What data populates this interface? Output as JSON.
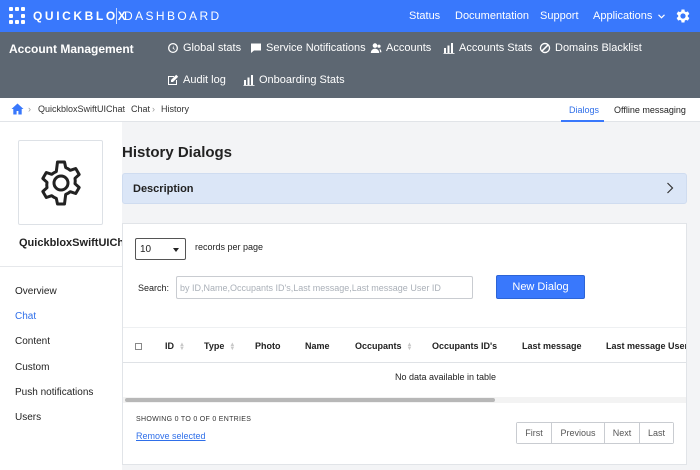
{
  "topbar": {
    "brand": "QUICKBLOX",
    "section": "DASHBOARD",
    "links": [
      "Status",
      "Documentation",
      "Support",
      "Applications"
    ],
    "settings_icon": "gear-icon"
  },
  "account_bar": {
    "title": "Account Management",
    "items": [
      {
        "label": "Global stats",
        "icon": "gauge-icon"
      },
      {
        "label": "Service Notifications",
        "icon": "chat-icon"
      },
      {
        "label": "Accounts",
        "icon": "users-icon"
      },
      {
        "label": "Accounts Stats",
        "icon": "bar-chart-icon"
      },
      {
        "label": "Domains Blacklist",
        "icon": "block-icon"
      },
      {
        "label": "Audit log",
        "icon": "edit-icon"
      },
      {
        "label": "Onboarding Stats",
        "icon": "bar-chart-icon"
      }
    ]
  },
  "breadcrumb": {
    "items": [
      "QuickbloxSwiftUIChat",
      "Chat",
      "History"
    ],
    "tabs": [
      {
        "label": "Dialogs",
        "active": true
      },
      {
        "label": "Offline messaging",
        "active": false
      }
    ]
  },
  "sidebar": {
    "app_name": "QuickbloxSwiftUIChat",
    "items": [
      {
        "label": "Overview",
        "active": false
      },
      {
        "label": "Chat",
        "active": true
      },
      {
        "label": "Content",
        "active": false
      },
      {
        "label": "Custom",
        "active": false
      },
      {
        "label": "Push notifications",
        "active": false
      },
      {
        "label": "Users",
        "active": false
      }
    ]
  },
  "main": {
    "title": "History Dialogs",
    "description_label": "Description",
    "page_size": "10",
    "records_per_page": "records per page",
    "search_label": "Search:",
    "search_placeholder": "by ID,Name,Occupants ID's,Last message,Last message User ID",
    "new_dialog": "New Dialog",
    "columns": [
      "ID",
      "Type",
      "Photo",
      "Name",
      "Occupants",
      "Occupants ID's",
      "Last message",
      "Last message User ID"
    ],
    "no_data": "No data available in table",
    "showing": "SHOWING 0 TO 0 OF 0 ENTRIES",
    "remove_selected": "Remove selected",
    "pager": [
      "First",
      "Previous",
      "Next",
      "Last"
    ]
  },
  "colors": {
    "primary": "#3978fc",
    "toolbar": "#5d6772",
    "link": "#2f6fe9",
    "description_bg": "#dbe6f7"
  }
}
